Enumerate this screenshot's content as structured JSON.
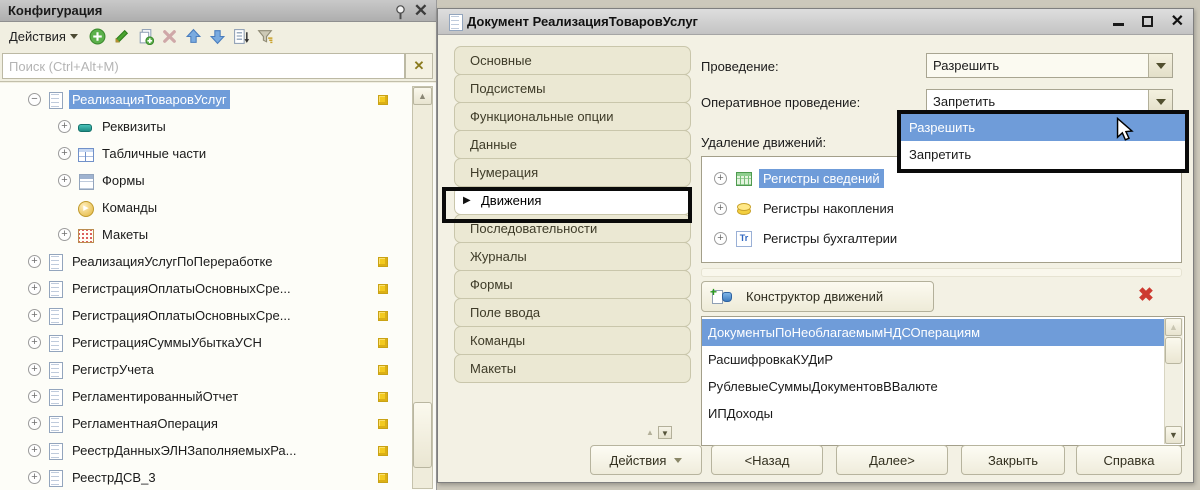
{
  "left_panel": {
    "title": "Конфигурация",
    "actions_label": "Действия",
    "search_placeholder": "Поиск (Ctrl+Alt+M)",
    "toolbar_icon_names": [
      "add-icon",
      "edit-icon",
      "copy-icon",
      "delete-icon",
      "move-up-icon",
      "move-down-icon",
      "sort-list-icon",
      "filter-icon"
    ],
    "tree": [
      {
        "label": "РеализацияТоваровУслуг"
      },
      {
        "label": "Реквизиты"
      },
      {
        "label": "Табличные части"
      },
      {
        "label": "Формы"
      },
      {
        "label": "Команды"
      },
      {
        "label": "Макеты"
      },
      {
        "label": "РеализацияУслугПоПереработке"
      },
      {
        "label": "РегистрацияОплатыОсновныхСре..."
      },
      {
        "label": "РегистрацияОплатыОсновныхСре..."
      },
      {
        "label": "РегистрацияСуммыУбыткаУСН"
      },
      {
        "label": "РегистрУчета"
      },
      {
        "label": "РегламентированныйОтчет"
      },
      {
        "label": "РегламентнаяОперация"
      },
      {
        "label": "РеестрДанныхЭЛНЗаполняемыхРа..."
      },
      {
        "label": "РеестрДСВ_3"
      }
    ]
  },
  "dialog": {
    "title": "Документ РеализацияТоваровУслуг",
    "tabs": [
      {
        "label": "Основные"
      },
      {
        "label": "Подсистемы"
      },
      {
        "label": "Функциональные опции"
      },
      {
        "label": "Данные"
      },
      {
        "label": "Нумерация"
      },
      {
        "label": "Движения"
      },
      {
        "label": "Последовательности"
      },
      {
        "label": "Журналы"
      },
      {
        "label": "Формы"
      },
      {
        "label": "Поле ввода"
      },
      {
        "label": "Команды"
      },
      {
        "label": "Макеты"
      }
    ],
    "active_tab": "Движения",
    "fields": {
      "provedenie_label": "Проведение:",
      "provedenie_value": "Разрешить",
      "operativnoe_label": "Оперативное проведение:",
      "operativnoe_value": "Запретить",
      "udalenie_label": "Удаление движений:"
    },
    "dropdown_options": [
      {
        "label": "Разрешить",
        "highlighted": true
      },
      {
        "label": "Запретить",
        "highlighted": false
      }
    ],
    "registers": [
      {
        "label": "Регистры сведений",
        "selected": true
      },
      {
        "label": "Регистры накопления",
        "selected": false
      },
      {
        "label": "Регистры бухгалтерии",
        "selected": false
      }
    ],
    "constructor_label": "Конструктор движений",
    "movements": [
      {
        "label": "ДокументыПоНеоблагаемымНДСОперациям",
        "selected": true
      },
      {
        "label": "РасшифровкаКУДиР",
        "selected": false
      },
      {
        "label": "РублевыеСуммыДокументовВВалюте",
        "selected": false
      },
      {
        "label": "ИПДоходы",
        "selected": false
      }
    ],
    "footer": {
      "actions": "Действия",
      "back": "<Назад",
      "next": "Далее>",
      "close": "Закрыть",
      "help": "Справка"
    }
  },
  "colors": {
    "selection_blue": "#6f9cd9",
    "panel_beige": "#f1efe1",
    "delete_red": "#cd3a30",
    "cube_gold": "#f3ca1f"
  }
}
